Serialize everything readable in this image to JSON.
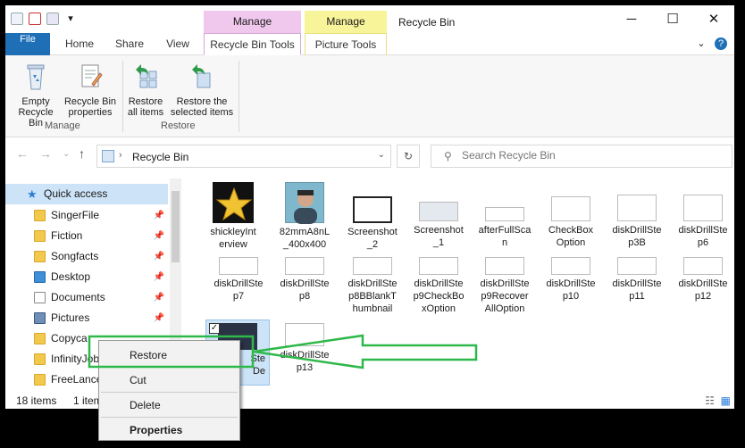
{
  "window": {
    "title": "Recycle Bin",
    "minimize": "─",
    "maximize": "☐",
    "close": "✕"
  },
  "context_tab_groups": {
    "pink": "Manage",
    "yellow": "Manage"
  },
  "tabs": {
    "file": "File",
    "home": "Home",
    "share": "Share",
    "view": "View",
    "recycle_bin_tools": "Recycle Bin Tools",
    "picture_tools": "Picture Tools",
    "expand": "⌄",
    "help": "?"
  },
  "ribbon": {
    "empty_line1": "Empty",
    "empty_line2": "Recycle Bin",
    "props_line1": "Recycle Bin",
    "props_line2": "properties",
    "manage_group": "Manage",
    "restore_all_line1": "Restore",
    "restore_all_line2": "all items",
    "restore_sel_line1": "Restore the",
    "restore_sel_line2": "selected items",
    "restore_group": "Restore"
  },
  "address": {
    "path": "Recycle Bin",
    "search_placeholder": "Search Recycle Bin"
  },
  "nav": {
    "quick_access": "Quick access",
    "items": [
      "SingerFile",
      "Fiction",
      "Songfacts",
      "Desktop",
      "Documents",
      "Pictures",
      "Copyca",
      "InfinityJob",
      "FreeLance"
    ]
  },
  "files": [
    {
      "line1": "shickleyInt",
      "line2": "erview"
    },
    {
      "line1": "82mmA8nL",
      "line2": "_400x400"
    },
    {
      "line1": "Screenshot",
      "line2": "_2"
    },
    {
      "line1": "Screenshot",
      "line2": "_1"
    },
    {
      "line1": "afterFullSca",
      "line2": "n"
    },
    {
      "line1": "CheckBox",
      "line2": "Option"
    },
    {
      "line1": "diskDrillSte",
      "line2": "p3B"
    },
    {
      "line1": "diskDrillSte",
      "line2": "p6"
    },
    {
      "line1": "diskDrillSte",
      "line2": "p7"
    },
    {
      "line1": "diskDrillSte",
      "line2": "p8"
    },
    {
      "line1": "diskDrillSte",
      "line2": "p8BBlankT",
      "line3": "humbnail"
    },
    {
      "line1": "diskDrillSte",
      "line2": "p9CheckBo",
      "line3": "xOption"
    },
    {
      "line1": "diskDrillSte",
      "line2": "p9Recover",
      "line3": "AllOption"
    },
    {
      "line1": "diskDrillSte",
      "line2": "p10"
    },
    {
      "line1": "diskDrillSte",
      "line2": "p11"
    },
    {
      "line1": "diskDrillSte",
      "line2": "p12"
    },
    {
      "line1": "diskDrillSte",
      "line2": "p13"
    }
  ],
  "selected_file_partial": {
    "line1": "Ste",
    "line2": "De"
  },
  "status": {
    "count": "18 items",
    "selected": "1 item"
  },
  "context_menu": {
    "restore": "Restore",
    "cut": "Cut",
    "delete": "Delete",
    "properties": "Properties"
  },
  "colors": {
    "annotation": "#2fb84a",
    "file_tab": "#1f6fb7",
    "selection": "#cde3f7",
    "manage_pink": "#f0c8ee",
    "manage_yellow": "#f8f49a"
  }
}
